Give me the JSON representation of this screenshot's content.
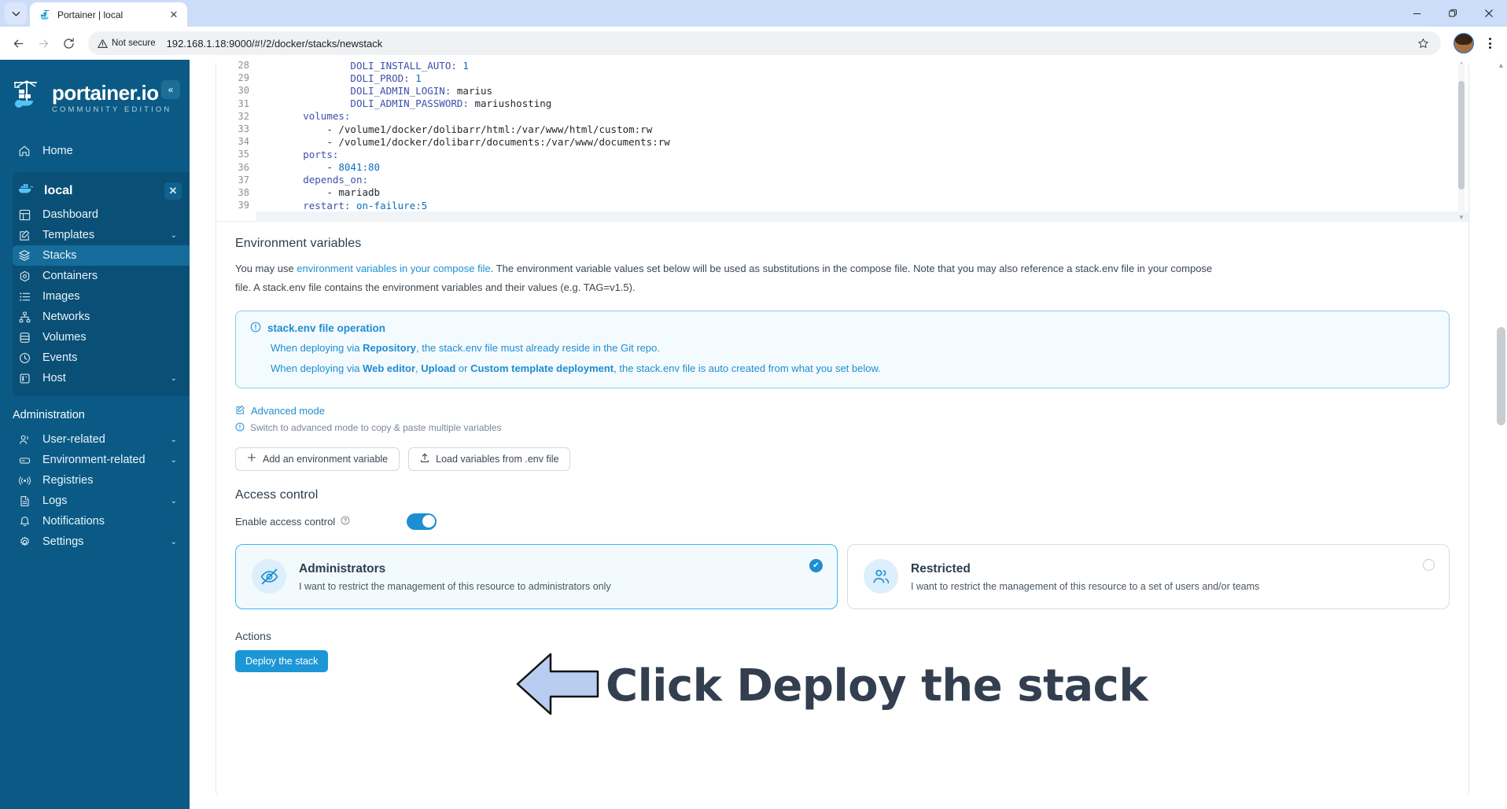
{
  "browser": {
    "tab": {
      "title": "Portainer | local",
      "favicon": "portainer-whale-icon",
      "close_label": "✕"
    },
    "tab_search_label": "⌄",
    "window_controls": {
      "minimize": "—",
      "maximize": "❐",
      "close": "✕"
    },
    "toolbar": {
      "back": "←",
      "forward": "→",
      "reload": "⟳",
      "security_label": "Not secure",
      "url": "192.168.1.18:9000/#!/2/docker/stacks/newstack",
      "bookmark": "☆"
    }
  },
  "sidebar": {
    "brand": {
      "name": "portainer.io",
      "subtitle": "COMMUNITY EDITION"
    },
    "collapse_label": "«",
    "home": {
      "label": "Home",
      "icon": "home-icon"
    },
    "environment": {
      "name": "local",
      "icon": "docker-whale-icon",
      "close_label": "✕",
      "items": [
        {
          "label": "Dashboard",
          "icon": "dashboard-icon",
          "chevron": "",
          "active": false
        },
        {
          "label": "Templates",
          "icon": "template-icon",
          "chevron": "⌄",
          "active": false
        },
        {
          "label": "Stacks",
          "icon": "stacks-icon",
          "chevron": "",
          "active": true
        },
        {
          "label": "Containers",
          "icon": "container-icon",
          "chevron": "",
          "active": false
        },
        {
          "label": "Images",
          "icon": "images-icon",
          "chevron": "",
          "active": false
        },
        {
          "label": "Networks",
          "icon": "networks-icon",
          "chevron": "",
          "active": false
        },
        {
          "label": "Volumes",
          "icon": "volumes-icon",
          "chevron": "",
          "active": false
        },
        {
          "label": "Events",
          "icon": "events-clock-icon",
          "chevron": "",
          "active": false
        },
        {
          "label": "Host",
          "icon": "host-icon",
          "chevron": "⌄",
          "active": false
        }
      ]
    },
    "administration": {
      "title": "Administration",
      "items": [
        {
          "label": "User-related",
          "icon": "users-icon",
          "chevron": "⌄"
        },
        {
          "label": "Environment-related",
          "icon": "environment-icon",
          "chevron": "⌄"
        },
        {
          "label": "Registries",
          "icon": "registries-icon",
          "chevron": ""
        },
        {
          "label": "Logs",
          "icon": "logs-document-icon",
          "chevron": "⌄"
        },
        {
          "label": "Notifications",
          "icon": "bell-icon",
          "chevron": ""
        },
        {
          "label": "Settings",
          "icon": "gear-icon",
          "chevron": "⌄"
        }
      ]
    }
  },
  "editor": {
    "lines": [
      {
        "n": "28",
        "indent": 8,
        "key": "DOLI_INSTALL_AUTO",
        "sep": ": ",
        "value": "1",
        "value_kind": "num"
      },
      {
        "n": "29",
        "indent": 8,
        "key": "DOLI_PROD",
        "sep": ": ",
        "value": "1",
        "value_kind": "num"
      },
      {
        "n": "30",
        "indent": 8,
        "key": "DOLI_ADMIN_LOGIN",
        "sep": ": ",
        "value": "marius",
        "value_kind": "str"
      },
      {
        "n": "31",
        "indent": 8,
        "key": "DOLI_ADMIN_PASSWORD",
        "sep": ": ",
        "value": "mariushosting",
        "value_kind": "str"
      },
      {
        "n": "32",
        "indent": 4,
        "key": "volumes",
        "sep": ":",
        "value": "",
        "value_kind": "str"
      },
      {
        "n": "33",
        "indent": 6,
        "key": "",
        "sep": "- ",
        "value": "/volume1/docker/dolibarr/html:/var/www/html/custom:rw",
        "value_kind": "str"
      },
      {
        "n": "34",
        "indent": 6,
        "key": "",
        "sep": "- ",
        "value": "/volume1/docker/dolibarr/documents:/var/www/documents:rw",
        "value_kind": "str"
      },
      {
        "n": "35",
        "indent": 4,
        "key": "ports",
        "sep": ":",
        "value": "",
        "value_kind": "str"
      },
      {
        "n": "36",
        "indent": 6,
        "key": "",
        "sep": "- ",
        "value": "8041:80",
        "value_kind": "num"
      },
      {
        "n": "37",
        "indent": 4,
        "key": "depends_on",
        "sep": ":",
        "value": "",
        "value_kind": "str"
      },
      {
        "n": "38",
        "indent": 6,
        "key": "",
        "sep": "- ",
        "value": "mariadb",
        "value_kind": "str"
      },
      {
        "n": "39",
        "indent": 4,
        "key": "restart",
        "sep": ": ",
        "value": "on-failure:5",
        "value_kind": "num"
      }
    ]
  },
  "env_section": {
    "title": "Environment variables",
    "desc_1": "You may use ",
    "desc_link": "environment variables in your compose file",
    "desc_2": ". The environment variable values set below will be used as substitutions in the compose file. Note that you may also reference a stack.env file in your compose file. A stack.env file contains the environment variables and their values (e.g. TAG=v1.5).",
    "info": {
      "icon": "info-circle-icon",
      "title": "stack.env file operation",
      "line1_a": "When deploying via ",
      "line1_b": "Repository",
      "line1_c": ", the stack.env file must already reside in the Git repo.",
      "line2_a": "When deploying via ",
      "line2_b": "Web editor",
      "line2_c": ", ",
      "line2_d": "Upload",
      "line2_e": " or ",
      "line2_f": "Custom template deployment",
      "line2_g": ", the stack.env file is auto created from what you set below."
    },
    "advanced_mode": {
      "label": "Advanced mode",
      "icon": "edit-pencil-icon"
    },
    "advanced_hint": {
      "label": "Switch to advanced mode to copy & paste multiple variables",
      "icon": "info-circle-icon"
    },
    "buttons": [
      {
        "label": "Add an environment variable",
        "icon": "plus-icon"
      },
      {
        "label": "Load variables from .env file",
        "icon": "upload-icon"
      }
    ]
  },
  "access_control": {
    "title": "Access control",
    "toggle_label": "Enable access control",
    "toggle_help_icon": "question-circle-icon",
    "toggle_enabled": true,
    "options": [
      {
        "title": "Administrators",
        "desc": "I want to restrict the management of this resource to administrators only",
        "icon": "eye-off-icon",
        "selected": true,
        "check_glyph": "✔"
      },
      {
        "title": "Restricted",
        "desc": "I want to restrict the management of this resource to a set of users and/or teams",
        "icon": "users-group-icon",
        "selected": false,
        "check_glyph": ""
      }
    ]
  },
  "actions": {
    "title": "Actions",
    "deploy_label": "Deploy the stack"
  },
  "annotation": {
    "text": "Click Deploy the stack",
    "arrow_icon": "left-arrow-annotation",
    "arrow_fill": "#b8cdf0",
    "text_color": "#333f4f"
  },
  "colors": {
    "sidebar_bg": "#0a5a85",
    "accent": "#1d8fd1",
    "deploy_button": "#1d96d6",
    "selected_card_border": "#3cb4f0",
    "info_box_border": "#8ecbf0"
  }
}
